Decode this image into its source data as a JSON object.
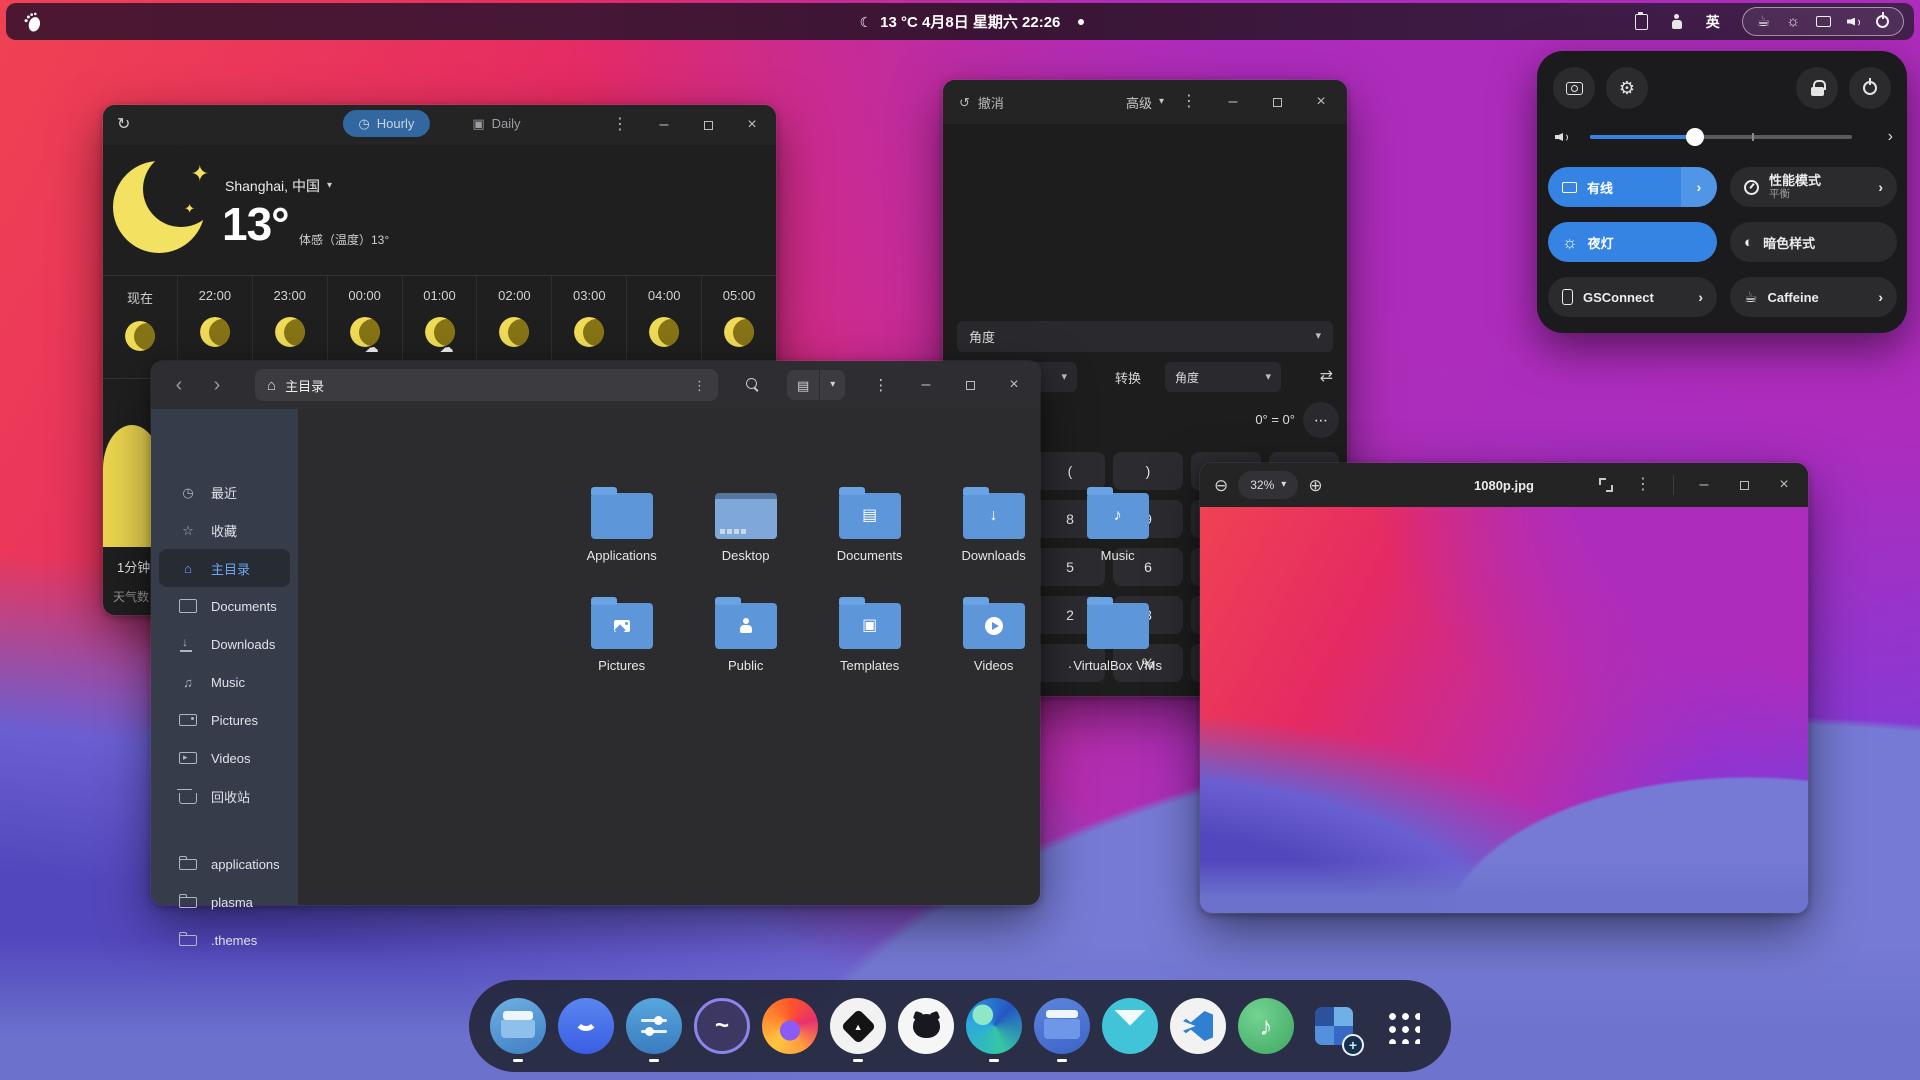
{
  "colors": {
    "accent": "#3584e4",
    "folder_blue": "#5d97da",
    "wallpaper_pink": "#e52a63",
    "wallpaper_periwinkle": "#767ad4"
  },
  "topbar": {
    "clock": "13 °C  4月8日 星期六  22:26",
    "input_method": "英"
  },
  "weather": {
    "tab_hourly": "Hourly",
    "tab_daily": "Daily",
    "location": "Shanghai, 中国",
    "temperature": "13°",
    "feels_like": "体感（温度）13°",
    "updated": "1分钟",
    "attribution": "天气数",
    "hours": [
      {
        "time": "现在"
      },
      {
        "time": "22:00"
      },
      {
        "time": "23:00"
      },
      {
        "time": "00:00"
      },
      {
        "time": "01:00"
      },
      {
        "time": "02:00"
      },
      {
        "time": "03:00"
      },
      {
        "time": "04:00"
      },
      {
        "time": "05:00"
      }
    ]
  },
  "calculator": {
    "undo_label": "撤消",
    "mode_label": "高级",
    "unit_dropdown": "角度",
    "convert_label": "转换",
    "convert_unit": "角度",
    "equation": "0° = 0°",
    "keys": [
      "(",
      ")",
      "8",
      "9",
      "5",
      "6",
      "2",
      "3",
      ".",
      "%"
    ]
  },
  "files": {
    "title": "主目录",
    "sidebar": [
      {
        "label": "最近"
      },
      {
        "label": "收藏"
      },
      {
        "label": "主目录"
      },
      {
        "label": "Documents"
      },
      {
        "label": "Downloads"
      },
      {
        "label": "Music"
      },
      {
        "label": "Pictures"
      },
      {
        "label": "Videos"
      },
      {
        "label": "回收站"
      }
    ],
    "bookmarks": [
      {
        "label": "applications"
      },
      {
        "label": "plasma"
      },
      {
        "label": ".themes"
      }
    ],
    "folders": [
      {
        "label": "Applications"
      },
      {
        "label": "Desktop"
      },
      {
        "label": "Documents"
      },
      {
        "label": "Downloads"
      },
      {
        "label": "Music"
      },
      {
        "label": "Pictures"
      },
      {
        "label": "Public"
      },
      {
        "label": "Templates"
      },
      {
        "label": "Videos"
      },
      {
        "label": "VirtualBox VMs"
      }
    ]
  },
  "viewer": {
    "zoom_level": "32%",
    "title": "1080p.jpg"
  },
  "quick_settings": {
    "wired_label": "有线",
    "power_mode_label": "性能模式",
    "power_mode_sub": "平衡",
    "night_light_label": "夜灯",
    "dark_style_label": "暗色样式",
    "gsconnect_label": "GSConnect",
    "caffeine_label": "Caffeine"
  },
  "dock": {
    "apps": [
      "files",
      "weather",
      "settings",
      "system-monitor",
      "firefox",
      "inkscape",
      "github",
      "edge",
      "file-manager",
      "mail",
      "vscode",
      "music",
      "software",
      "app-grid"
    ]
  }
}
